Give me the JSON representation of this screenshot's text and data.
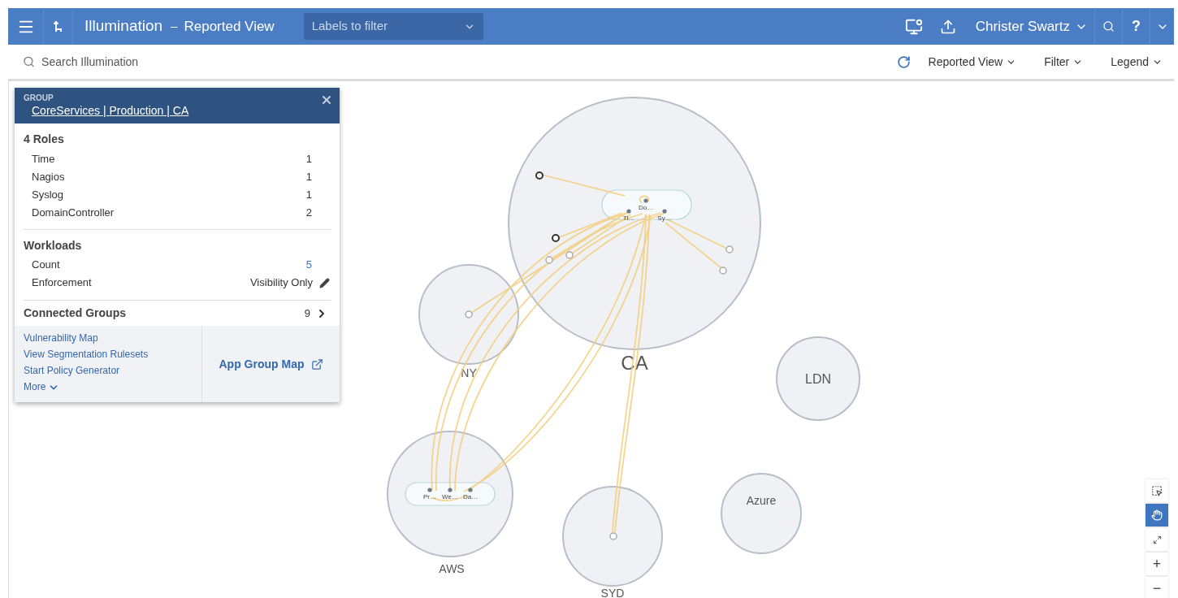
{
  "header": {
    "title": "Illumination",
    "separator": "–",
    "view": "Reported View",
    "label_filter": {
      "placeholder": "Labels to filter"
    },
    "user": "Christer Swartz",
    "help": "?"
  },
  "toolbar": {
    "search": {
      "placeholder": "Search Illumination"
    },
    "menus": [
      "Reported View",
      "Filter",
      "Legend"
    ]
  },
  "panel": {
    "kind_label": "GROUP",
    "title": "CoreServices | Production | CA",
    "roles_heading": "4 Roles",
    "roles": [
      {
        "name": "Time",
        "count": "1"
      },
      {
        "name": "Nagios",
        "count": "1"
      },
      {
        "name": "Syslog",
        "count": "1"
      },
      {
        "name": "DomainController",
        "count": "2"
      }
    ],
    "workloads_heading": "Workloads",
    "count_label": "Count",
    "count": "5",
    "enforcement_label": "Enforcement",
    "enforcement": "Visibility Only",
    "connected_label": "Connected Groups",
    "connected_count": "9",
    "links": [
      "Vulnerability Map",
      "View Segmentation Rulesets",
      "Start Policy Generator"
    ],
    "more": "More",
    "app_group_map": "App Group Map"
  },
  "map": {
    "groups": [
      {
        "label": "CA",
        "kind": "expanded",
        "roles": [
          "Do…",
          "Ti…",
          "Sy…"
        ]
      },
      {
        "label": "NY",
        "kind": "collapsed"
      },
      {
        "label": "LDN",
        "kind": "collapsed"
      },
      {
        "label": "AWS",
        "kind": "expanded",
        "roles": [
          "Pr…",
          "We…",
          "Da…"
        ]
      },
      {
        "label": "SYD",
        "kind": "collapsed"
      },
      {
        "label": "Azure",
        "kind": "collapsed"
      }
    ]
  },
  "zoom_controls": [
    {
      "kind": "select",
      "selected": false
    },
    {
      "kind": "pan",
      "selected": true
    },
    {
      "kind": "fit",
      "selected": false
    },
    {
      "kind": "zoom-in",
      "label": "+",
      "selected": false
    },
    {
      "kind": "zoom-out",
      "label": "−",
      "selected": false
    }
  ]
}
